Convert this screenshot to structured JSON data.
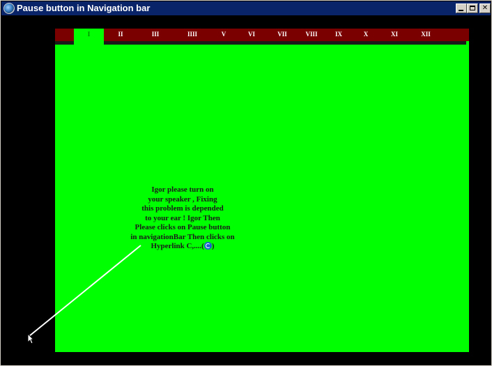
{
  "window": {
    "title": "Pause button in Navigation bar",
    "minimize": "minimize",
    "maximize": "maximize",
    "close": "✕"
  },
  "navbar": {
    "items": [
      "I",
      "II",
      "III",
      "IIII",
      "V",
      "VI",
      "VII",
      "VIII",
      "IX",
      "X",
      "XI",
      "XII"
    ],
    "active_index": 0
  },
  "message": {
    "lines": [
      "Igor please turn on",
      "your speaker , Fixing",
      "this problem is depended",
      "to your ear ! Igor Then",
      "Please clicks on  Pause button",
      "in navigationBar Then clicks on",
      "Hyperlink C,....("
    ],
    "line_end": ")"
  },
  "colors": {
    "navbar": "#7a0000",
    "panel": "#00ff00",
    "background": "#000000",
    "titlebar": "#0a246a"
  }
}
